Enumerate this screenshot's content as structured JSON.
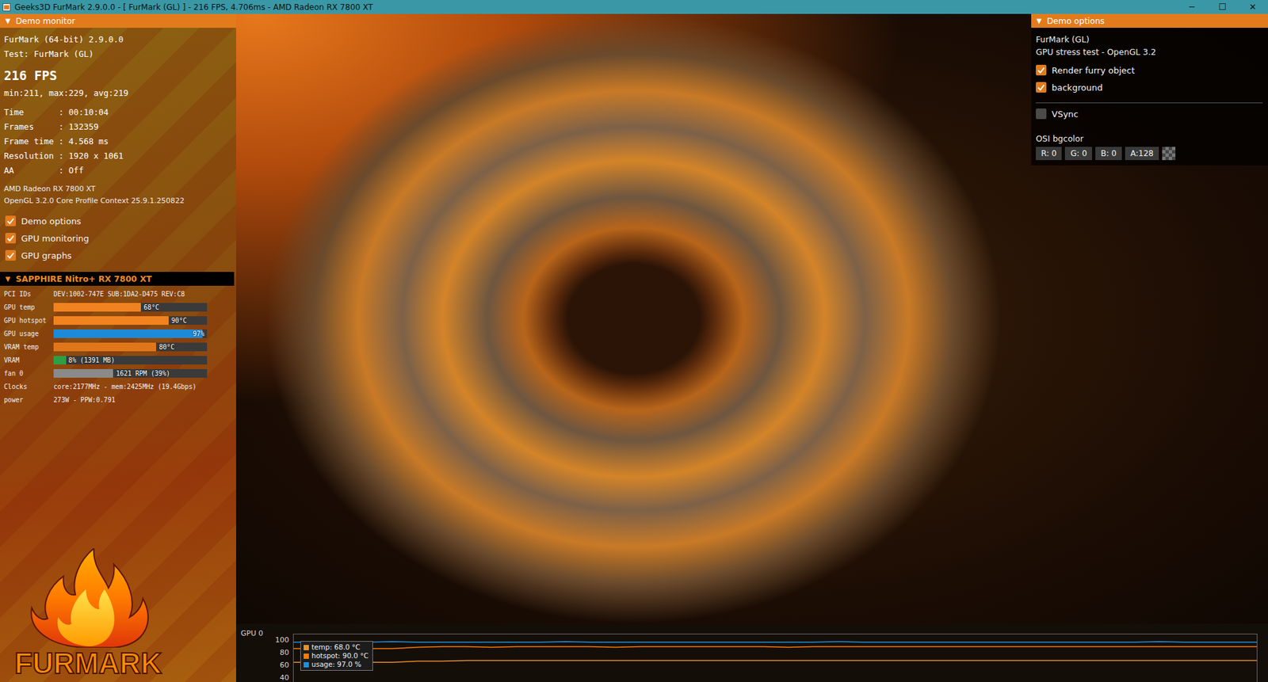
{
  "window": {
    "title": "Geeks3D FurMark 2.9.0.0 - [ FurMark (GL) ] - 216 FPS, 4.706ms - AMD Radeon RX 7800 XT",
    "controls": [
      "─",
      "☐",
      "✕"
    ]
  },
  "monitor": {
    "header": {
      "arrow": "▼",
      "title": "Demo monitor"
    },
    "lines": [
      "FurMark (64-bit) 2.9.0.0",
      "Test: FurMark (GL)"
    ],
    "fps": "216 FPS",
    "fps_stats": "min:211, max:229, avg:219",
    "stats": [
      {
        "label": "Time",
        "value": ": 00:10:04"
      },
      {
        "label": "Frames",
        "value": ": 132359"
      },
      {
        "label": "Frame time",
        "value": ": 4.568 ms"
      },
      {
        "label": "Resolution",
        "value": ": 1920 x 1061"
      },
      {
        "label": "AA",
        "value": ": Off"
      }
    ],
    "gpu_name": "AMD Radeon RX 7800 XT",
    "context": "OpenGL 3.2.0 Core Profile Context 25.9.1.250822",
    "toggles": [
      {
        "label": "Demo options",
        "checked": true
      },
      {
        "label": "GPU monitoring",
        "checked": true
      },
      {
        "label": "GPU graphs",
        "checked": true
      }
    ],
    "gpu": {
      "arrow": "▼",
      "name": "SAPPHIRE Nitro+ RX 7800 XT",
      "rows": [
        {
          "kind": "text",
          "label": "PCI IDs",
          "value": "DEV:1002-747E SUB:1DA2-D475 REV:C8"
        },
        {
          "kind": "bar",
          "label": "GPU temp",
          "value": "68°C",
          "level": 0.57,
          "color": "#f0831f"
        },
        {
          "kind": "bar",
          "label": "GPU hotspot",
          "value": "90°C",
          "level": 0.75,
          "color": "#f0831f"
        },
        {
          "kind": "bar",
          "label": "GPU usage",
          "value": "97%",
          "level": 0.97,
          "color": "#1d8ad8"
        },
        {
          "kind": "bar",
          "label": "VRAM temp",
          "value": "80°C",
          "level": 0.67,
          "color": "#e0761a"
        },
        {
          "kind": "bar",
          "label": "VRAM",
          "value": "8% (1391 MB)",
          "level": 0.08,
          "color": "#2f9e45"
        },
        {
          "kind": "bar",
          "label": "fan 0",
          "value": "1621 RPM (39%)",
          "level": 0.39,
          "color": "#8a8a8a"
        },
        {
          "kind": "text",
          "label": "Clocks",
          "value": "core:2177MHz - mem:2425MHz (19.4Gbps)"
        },
        {
          "kind": "text",
          "label": "power",
          "value": "273W - PPW:0.791"
        }
      ]
    }
  },
  "logo": {
    "text": "FURMARK"
  },
  "options": {
    "header": {
      "arrow": "▼",
      "title": "Demo options"
    },
    "lines": [
      "FurMark (GL)",
      "GPU stress test - OpenGL 3.2"
    ],
    "toggles": [
      {
        "label": "Render furry object",
        "checked": true
      },
      {
        "label": "background",
        "checked": true
      }
    ],
    "vsync": {
      "label": "VSync",
      "checked": false
    },
    "bgcolor": {
      "label": "OSI bgcolor",
      "chips": [
        "R: 0",
        "G: 0",
        "B: 0",
        "A:128"
      ]
    }
  },
  "graph": {
    "title": "GPU 0",
    "y_ticks": [
      "100",
      "80",
      "60",
      "40"
    ],
    "series": [
      {
        "name": "temp",
        "legend": "temp: 68.0 °C",
        "color": "#e8902a",
        "values": [
          65,
          65,
          65,
          65,
          65,
          67,
          67,
          68,
          68,
          68,
          68,
          68,
          68,
          68,
          68,
          68,
          68,
          68,
          68,
          68,
          68,
          68,
          68,
          68,
          68,
          68,
          68,
          68,
          68,
          68,
          68,
          68,
          68,
          68,
          68,
          68,
          68,
          68,
          68,
          68
        ]
      },
      {
        "name": "hotspot",
        "legend": "hotspot: 90.0 °C",
        "color": "#ff7a00",
        "values": [
          87,
          87,
          87,
          87,
          87,
          89,
          90,
          90,
          89,
          90,
          90,
          90,
          90,
          89,
          90,
          90,
          90,
          90,
          90,
          90,
          89,
          90,
          90,
          90,
          90,
          90,
          90,
          90,
          90,
          90,
          90,
          90,
          90,
          90,
          90,
          90,
          90,
          90,
          90,
          90
        ]
      },
      {
        "name": "usage",
        "legend": "usage: 97.0 %",
        "color": "#1e90e0",
        "values": [
          97,
          97,
          97,
          97,
          98,
          97,
          97,
          97,
          97,
          97,
          97,
          98,
          97,
          97,
          97,
          97,
          97,
          97,
          97,
          97,
          97,
          97,
          98,
          97,
          97,
          97,
          97,
          97,
          97,
          97,
          97,
          97,
          97,
          97,
          97,
          98,
          97,
          97,
          97,
          97
        ]
      }
    ]
  }
}
